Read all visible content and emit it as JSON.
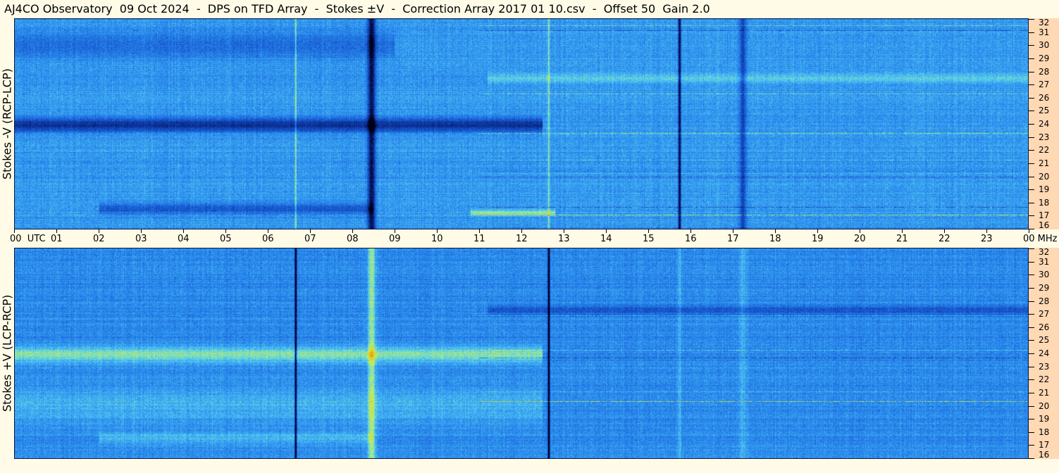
{
  "title": "AJ4CO Observatory  09 Oct 2024  -  DPS on TFD Array  -  Stokes ±V  -  Correction Array 2017 01 10.csv  -  Offset 50  Gain 2.0",
  "chart_data": [
    {
      "type": "heatmap",
      "panel": "top",
      "ylabel": "Stokes -V (RCP-LCP)",
      "x_unit": "UTC",
      "x_ticks": [
        "00",
        "01",
        "02",
        "03",
        "04",
        "05",
        "06",
        "07",
        "08",
        "09",
        "10",
        "11",
        "12",
        "13",
        "14",
        "15",
        "16",
        "17",
        "18",
        "19",
        "20",
        "21",
        "22",
        "23",
        "00"
      ],
      "y_unit": "MHz",
      "y_ticks": [
        16,
        17,
        18,
        19,
        20,
        21,
        22,
        23,
        24,
        25,
        26,
        27,
        28,
        29,
        30,
        31,
        32
      ],
      "xlim": [
        0,
        24
      ],
      "ylim": [
        16,
        32
      ],
      "colormap": [
        "#000018",
        "#0a2a8a",
        "#1450c8",
        "#2a8cf0",
        "#5ad2ee",
        "#c8f050",
        "#f0c010",
        "#e03020"
      ],
      "base_level": 0.45,
      "features": [
        {
          "kind": "band",
          "freq": 23.9,
          "width": 0.7,
          "t_start": 0,
          "t_end": 12.5,
          "delta": -0.28
        },
        {
          "kind": "band",
          "freq": 17.5,
          "width": 0.6,
          "t_start": 2,
          "t_end": 8.5,
          "delta": -0.15
        },
        {
          "kind": "band",
          "freq": 30.0,
          "width": 1.4,
          "t_start": 0,
          "t_end": 9,
          "delta": -0.1
        },
        {
          "kind": "column",
          "t": 8.45,
          "width": 0.12,
          "delta": -0.4
        },
        {
          "kind": "column",
          "t": 15.75,
          "width": 0.04,
          "delta": -0.45
        },
        {
          "kind": "column",
          "t": 6.65,
          "width": 0.03,
          "delta": 0.2
        },
        {
          "kind": "column",
          "t": 12.65,
          "width": 0.03,
          "delta": 0.2
        },
        {
          "kind": "column",
          "t": 17.25,
          "width": 0.12,
          "delta": -0.2
        },
        {
          "kind": "band",
          "freq": 27.5,
          "width": 0.5,
          "t_start": 11.2,
          "t_end": 24,
          "delta": 0.12
        },
        {
          "kind": "band",
          "freq": 17.2,
          "width": 0.3,
          "t_start": 10.8,
          "t_end": 12.8,
          "delta": 0.2
        }
      ]
    },
    {
      "type": "heatmap",
      "panel": "bottom",
      "ylabel": "Stokes +V (LCP-RCP)",
      "x_unit": "UTC",
      "x_ticks": [
        "00",
        "01",
        "02",
        "03",
        "04",
        "05",
        "06",
        "07",
        "08",
        "09",
        "10",
        "11",
        "12",
        "13",
        "14",
        "15",
        "16",
        "17",
        "18",
        "19",
        "20",
        "21",
        "22",
        "23",
        "00"
      ],
      "y_unit": "MHz",
      "y_ticks": [
        16,
        17,
        18,
        19,
        20,
        21,
        22,
        23,
        24,
        25,
        26,
        27,
        28,
        29,
        30,
        31,
        32
      ],
      "xlim": [
        0,
        24
      ],
      "ylim": [
        16,
        32
      ],
      "colormap": [
        "#000018",
        "#0a2a8a",
        "#1450c8",
        "#2a8cf0",
        "#5ad2ee",
        "#c8f050",
        "#f0c010",
        "#e03020"
      ],
      "base_level": 0.42,
      "features": [
        {
          "kind": "band",
          "freq": 23.9,
          "width": 0.8,
          "t_start": 0,
          "t_end": 12.5,
          "delta": 0.22
        },
        {
          "kind": "band",
          "freq": 17.5,
          "width": 0.6,
          "t_start": 2,
          "t_end": 8.5,
          "delta": 0.1
        },
        {
          "kind": "band",
          "freq": 20.0,
          "width": 2.0,
          "t_start": 0,
          "t_end": 12.5,
          "delta": 0.08
        },
        {
          "kind": "column",
          "t": 8.45,
          "width": 0.12,
          "delta": 0.25
        },
        {
          "kind": "column",
          "t": 6.65,
          "width": 0.03,
          "delta": -0.6
        },
        {
          "kind": "column",
          "t": 12.65,
          "width": 0.03,
          "delta": -0.6
        },
        {
          "kind": "column",
          "t": 15.75,
          "width": 0.05,
          "delta": 0.1
        },
        {
          "kind": "column",
          "t": 17.25,
          "width": 0.12,
          "delta": 0.08
        },
        {
          "kind": "band",
          "freq": 27.3,
          "width": 0.5,
          "t_start": 11.2,
          "t_end": 24,
          "delta": -0.12
        }
      ]
    }
  ]
}
